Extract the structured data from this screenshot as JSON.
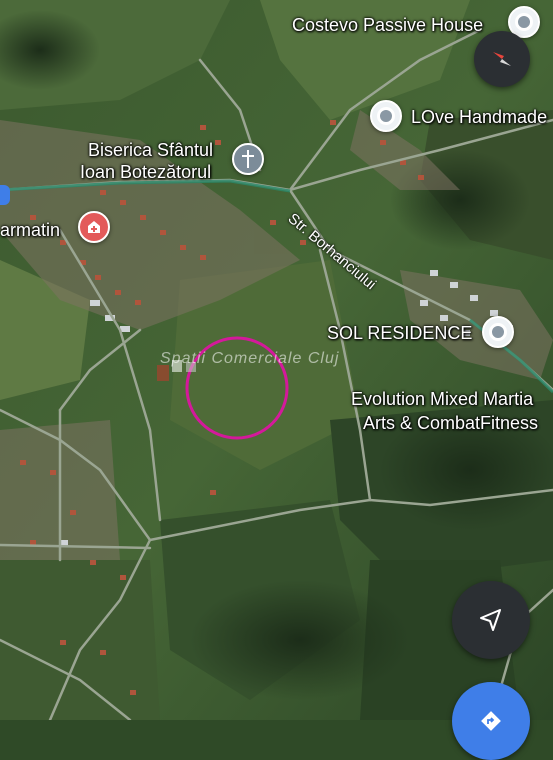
{
  "map": {
    "places": [
      {
        "name": "Costevo Passive House",
        "icon": "location-pin-icon"
      },
      {
        "name": "LOve Handmade",
        "icon": "location-pin-icon"
      },
      {
        "name": "Biserica Sfântul",
        "name2": "Ioan Botezătorul",
        "icon": "church-cross-icon"
      },
      {
        "name": "armatin",
        "icon": "pharmacy-icon"
      },
      {
        "name": "SOL RESIDENCE",
        "icon": "location-pin-icon"
      },
      {
        "name": "Evolution Mixed Martia",
        "name2": "Arts & CombatFitness"
      }
    ],
    "street_label": "Str. Borhanciului",
    "watermark": "Spatii Comerciale Cluj",
    "colors": {
      "highlight_circle": "#d4199b",
      "road": "#8c9a85",
      "route_accent": "#3f7ee8",
      "pharmacy_red": "#e35a5a"
    }
  },
  "controls": {
    "compass": "compass-icon",
    "navigate": "navigation-arrow-icon",
    "directions": "directions-icon"
  }
}
